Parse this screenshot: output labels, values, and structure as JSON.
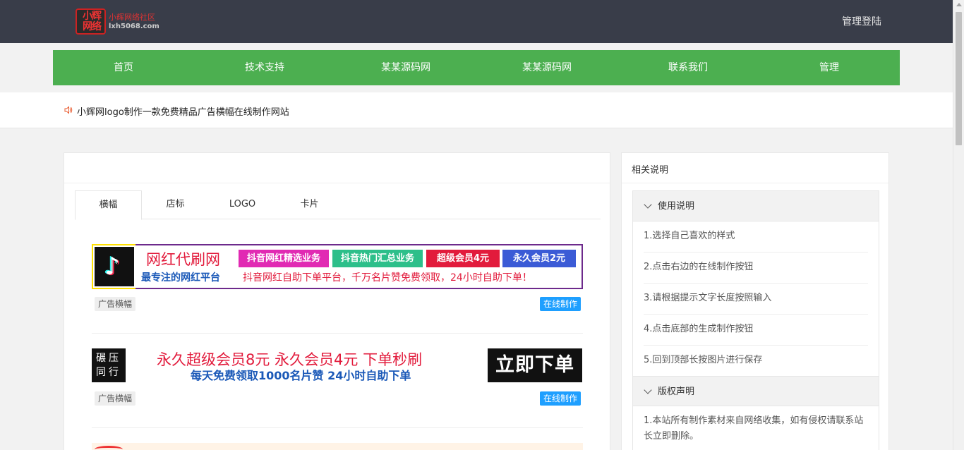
{
  "header": {
    "logo_char_1": "小辉",
    "logo_char_2": "网络",
    "logo_name": "小辉网络社区",
    "logo_domain": "lxh5068.com",
    "admin_login": "管理登陆"
  },
  "nav": {
    "items": [
      "首页",
      "技术支持",
      "某某源码网",
      "某某源码网",
      "联系我们",
      "管理"
    ]
  },
  "notice": {
    "text": "小辉网logo制作一款免费精品广告横幅在线制作网站"
  },
  "tabs": [
    "横幅",
    "店标",
    "LOGO",
    "卡片"
  ],
  "items": [
    {
      "tag": "广告横幅",
      "button": "在线制作",
      "banner": {
        "title": "网红代刷网",
        "chips": [
          "抖音网红精选业务",
          "抖音热门汇总业务",
          "超级会员4元",
          "永久会员2元"
        ],
        "subtitle": "最专注的网红平台",
        "subtitle2": "抖音网红自助下单平台，千万名片赞免费领取，24小时自助下单！"
      }
    },
    {
      "tag": "广告横幅",
      "button": "在线制作",
      "banner": {
        "left": "碾压同行",
        "line1": "永久超级会员8元  永久会员4元  下单秒刷",
        "line2": "每天免费领取1000名片赞  24小时自助下单",
        "right": "立即下单"
      }
    }
  ],
  "colors": {
    "topbar": "#393d49",
    "nav": "#4caf50",
    "button": "#1e9fff",
    "chips": [
      "#e12ab3",
      "#2dbf8a",
      "#e21b3c",
      "#3b5bd6"
    ]
  },
  "side": {
    "title": "相关说明",
    "sections": [
      {
        "title": "使用说明",
        "lines": [
          "1.选择自己喜欢的样式",
          "2.点击右边的在线制作按钮",
          "3.请根据提示文字长度按照输入",
          "4.点击底部的生成制作按钮",
          "5.回到顶部长按图片进行保存"
        ]
      },
      {
        "title": "版权声明",
        "lines": [
          "1.本站所有制作素材来自网络收集，如有侵权请联系站长立即删除。"
        ]
      }
    ]
  }
}
